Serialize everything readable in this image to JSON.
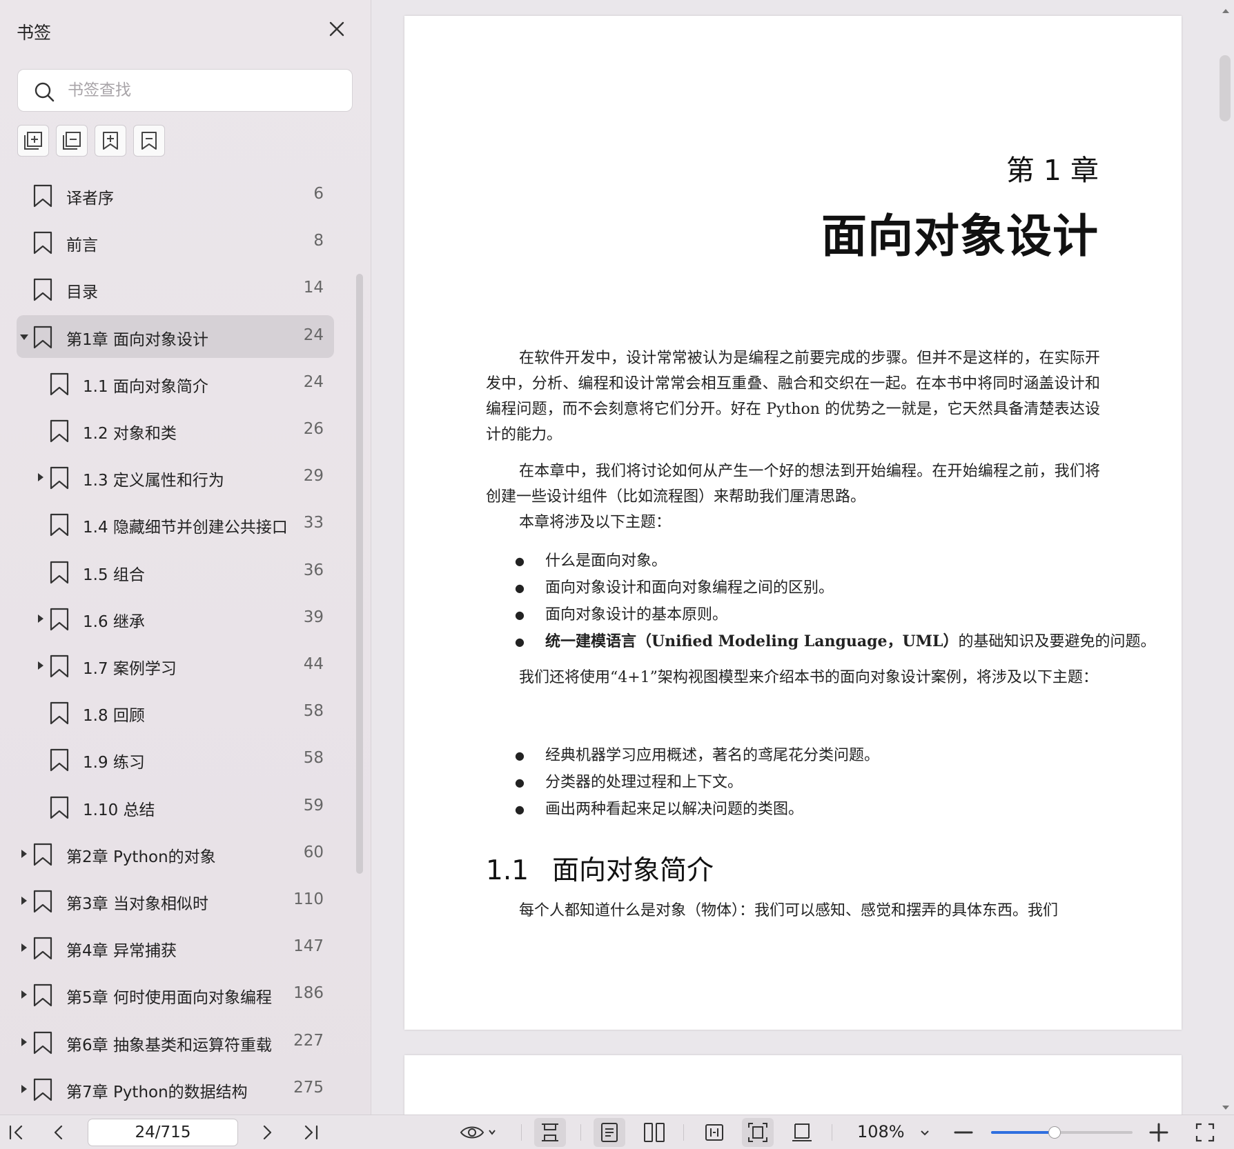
{
  "sidebar": {
    "title": "书签",
    "search_placeholder": "书签查找",
    "toolbar": [
      {
        "name": "expand-all-icon"
      },
      {
        "name": "collapse-all-icon"
      },
      {
        "name": "add-bookmark-icon"
      },
      {
        "name": "remove-bookmark-icon"
      }
    ],
    "items": [
      {
        "label": "译者序",
        "page": "6",
        "level": 0,
        "arrow": "none",
        "selected": false
      },
      {
        "label": "前言",
        "page": "8",
        "level": 0,
        "arrow": "none",
        "selected": false
      },
      {
        "label": "目录",
        "page": "14",
        "level": 0,
        "arrow": "none",
        "selected": false
      },
      {
        "label": "第1章 面向对象设计",
        "page": "24",
        "level": 0,
        "arrow": "expanded",
        "selected": true
      },
      {
        "label": "1.1 面向对象简介",
        "page": "24",
        "level": 1,
        "arrow": "none",
        "selected": false
      },
      {
        "label": "1.2 对象和类",
        "page": "26",
        "level": 1,
        "arrow": "none",
        "selected": false
      },
      {
        "label": "1.3 定义属性和行为",
        "page": "29",
        "level": 1,
        "arrow": "collapsed",
        "selected": false
      },
      {
        "label": "1.4 隐藏细节并创建公共接口",
        "page": "33",
        "level": 1,
        "arrow": "none",
        "selected": false
      },
      {
        "label": "1.5 组合",
        "page": "36",
        "level": 1,
        "arrow": "none",
        "selected": false
      },
      {
        "label": "1.6 继承",
        "page": "39",
        "level": 1,
        "arrow": "collapsed",
        "selected": false
      },
      {
        "label": "1.7 案例学习",
        "page": "44",
        "level": 1,
        "arrow": "collapsed",
        "selected": false
      },
      {
        "label": "1.8 回顾",
        "page": "58",
        "level": 1,
        "arrow": "none",
        "selected": false
      },
      {
        "label": "1.9 练习",
        "page": "58",
        "level": 1,
        "arrow": "none",
        "selected": false
      },
      {
        "label": "1.10 总结",
        "page": "59",
        "level": 1,
        "arrow": "none",
        "selected": false
      },
      {
        "label": "第2章 Python的对象",
        "page": "60",
        "level": 0,
        "arrow": "collapsed",
        "selected": false
      },
      {
        "label": "第3章 当对象相似时",
        "page": "110",
        "level": 0,
        "arrow": "collapsed",
        "selected": false
      },
      {
        "label": "第4章 异常捕获",
        "page": "147",
        "level": 0,
        "arrow": "collapsed",
        "selected": false
      },
      {
        "label": "第5章 何时使用面向对象编程",
        "page": "186",
        "level": 0,
        "arrow": "collapsed",
        "selected": false
      },
      {
        "label": "第6章 抽象基类和运算符重载",
        "page": "227",
        "level": 0,
        "arrow": "collapsed",
        "selected": false
      },
      {
        "label": "第7章 Python的数据结构",
        "page": "275",
        "level": 0,
        "arrow": "collapsed",
        "selected": false
      }
    ]
  },
  "document": {
    "chapter_number": "第 1 章",
    "chapter_title": "面向对象设计",
    "paragraphs": [
      "在软件开发中，设计常常被认为是编程之前要完成的步骤。但并不是这样的，在实际开发中，分析、编程和设计常常会相互重叠、融合和交织在一起。在本书中将同时涵盖设计和编程问题，而不会刻意将它们分开。好在 Python 的优势之一就是，它天然具备清楚表达设计的能力。",
      "在本章中，我们将讨论如何从产生一个好的想法到开始编程。在开始编程之前，我们将创建一些设计组件（比如流程图）来帮助我们厘清思路。",
      "本章将涉及以下主题：",
      "我们还将使用“4+1”架构视图模型来介绍本书的面向对象设计案例，将涉及以下主题：",
      "每个人都知道什么是对象（物体）：我们可以感知、感觉和摆弄的具体东西。我们"
    ],
    "bullets_1": [
      "什么是面向对象。",
      "面向对象设计和面向对象编程之间的区别。",
      "面向对象设计的基本原则。"
    ],
    "bullet_uml_bold": "统一建模语言（Unified Modeling Language，UML）",
    "bullet_uml_rest": "的基础知识及要避免的问题。",
    "bullets_2": [
      "经典机器学习应用概述，著名的鸢尾花分类问题。",
      "分类器的处理过程和上下文。",
      "画出两种看起来足以解决问题的类图。"
    ],
    "section_number": "1.1",
    "section_title": "面向对象简介"
  },
  "bottombar": {
    "page_value": "24/715",
    "zoom_label": "108%",
    "zoom_fraction": 0.45
  }
}
